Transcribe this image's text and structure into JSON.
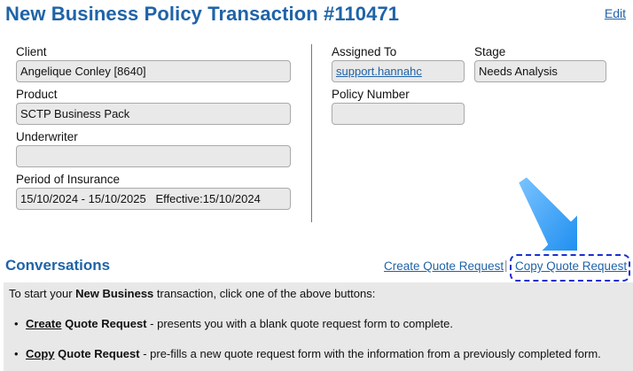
{
  "header": {
    "title": "New Business Policy Transaction #110471",
    "edit_label": "Edit"
  },
  "details": {
    "client_label": "Client",
    "client_value": "Angelique Conley [8640]",
    "product_label": "Product",
    "product_value": "SCTP Business Pack",
    "underwriter_label": "Underwriter",
    "underwriter_value": "",
    "period_label": "Period of Insurance",
    "period_value": "15/10/2024 - 15/10/2025   Effective:15/10/2024",
    "assigned_label": "Assigned To",
    "assigned_value": "support.hannahc",
    "stage_label": "Stage",
    "stage_value": "Needs Analysis",
    "policy_number_label": "Policy Number",
    "policy_number_value": ""
  },
  "conversations": {
    "title": "Conversations",
    "create_quote_label": "Create Quote Request",
    "separator": "|",
    "copy_quote_label": "Copy Quote Request"
  },
  "instructions": {
    "intro_prefix": "To start your ",
    "intro_bold": "New Business",
    "intro_suffix": " transaction, click one of the above buttons:",
    "create_keyword": "Create",
    "create_title_rest": " Quote Request",
    "create_desc": " - presents you with a blank quote request form to complete.",
    "copy_keyword": "Copy",
    "copy_title_rest": " Quote Request",
    "copy_desc": " - pre-fills a new quote request form with the information from a previously completed form."
  },
  "colors": {
    "accent": "#1f63a8",
    "highlight_arrow": "#1f8ff0",
    "highlight_ring": "#1a2fd0"
  }
}
